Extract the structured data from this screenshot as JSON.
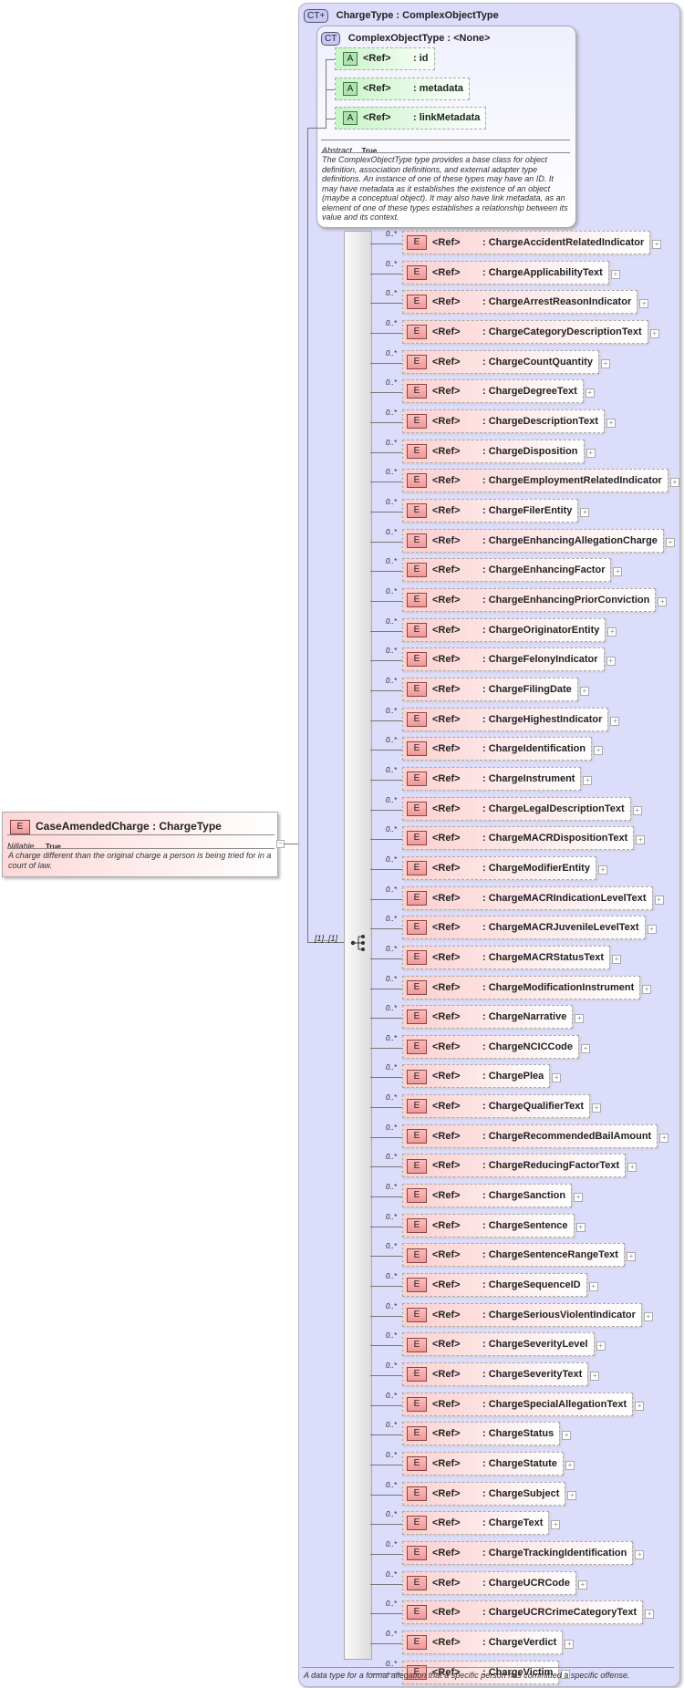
{
  "root_element": {
    "icon": "E",
    "name": "CaseAmendedCharge",
    "type": ": ChargeType",
    "nillable_label": "Nillable",
    "nillable_value": "True",
    "description": "A charge different than the original charge a person is being tried for in a court of law."
  },
  "charge_type": {
    "icon": "CT+",
    "title": "ChargeType : ComplexObjectType",
    "description": "A data type for a formal allegation that a specific person has committed a specific offense.",
    "sequence_multiplicity": "[1]..[1]"
  },
  "complex_object_type": {
    "icon": "CT",
    "title": "ComplexObjectType : <None>",
    "attributes": [
      {
        "icon": "A",
        "ref": "<Ref>",
        "name": ": id"
      },
      {
        "icon": "A",
        "ref": "<Ref>",
        "name": ": metadata"
      },
      {
        "icon": "A",
        "ref": "<Ref>",
        "name": ": linkMetadata"
      }
    ],
    "abstract_label": "Abstract",
    "abstract_value": "True",
    "description": "The ComplexObjectType type provides a base class for object definition, association definitions, and external adapter type definitions. An instance of one of these types may have an ID. It may have metadata as it establishes the existence of an object (maybe a conceptual object). It may also have link metadata, as an element of one of these types establishes a relationship between its value and its context."
  },
  "elements": [
    "ChargeAccidentRelatedIndicator",
    "ChargeApplicabilityText",
    "ChargeArrestReasonIndicator",
    "ChargeCategoryDescriptionText",
    "ChargeCountQuantity",
    "ChargeDegreeText",
    "ChargeDescriptionText",
    "ChargeDisposition",
    "ChargeEmploymentRelatedIndicator",
    "ChargeFilerEntity",
    "ChargeEnhancingAllegationCharge",
    "ChargeEnhancingFactor",
    "ChargeEnhancingPriorConviction",
    "ChargeOriginatorEntity",
    "ChargeFelonyIndicator",
    "ChargeFilingDate",
    "ChargeHighestIndicator",
    "ChargeIdentification",
    "ChargeInstrument",
    "ChargeLegalDescriptionText",
    "ChargeMACRDispositionText",
    "ChargeModifierEntity",
    "ChargeMACRIndicationLevelText",
    "ChargeMACRJuvenileLevelText",
    "ChargeMACRStatusText",
    "ChargeModificationInstrument",
    "ChargeNarrative",
    "ChargeNCICCode",
    "ChargePlea",
    "ChargeQualifierText",
    "ChargeRecommendedBailAmount",
    "ChargeReducingFactorText",
    "ChargeSanction",
    "ChargeSentence",
    "ChargeSentenceRangeText",
    "ChargeSequenceID",
    "ChargeSeriousViolentIndicator",
    "ChargeSeverityLevel",
    "ChargeSeverityText",
    "ChargeSpecialAllegationText",
    "ChargeStatus",
    "ChargeStatute",
    "ChargeSubject",
    "ChargeText",
    "ChargeTrackingIdentification",
    "ChargeUCRCode",
    "ChargeUCRCrimeCategoryText",
    "ChargeVerdict",
    "ChargeVictim"
  ],
  "element_row": {
    "icon": "E",
    "ref": "<Ref>",
    "multiplicity": "0..*",
    "prefix": ": "
  }
}
